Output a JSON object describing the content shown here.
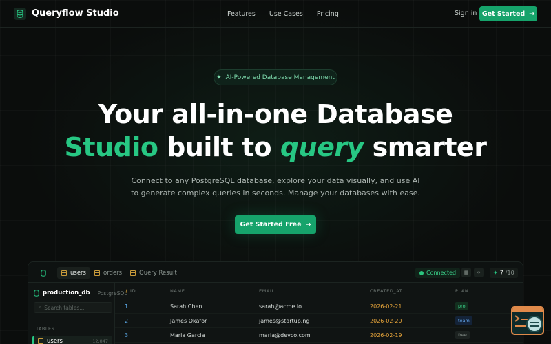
{
  "nav": {
    "brand": "Queryflow Studio",
    "links": [
      "Features",
      "Use Cases",
      "Pricing"
    ],
    "sign_in": "Sign in",
    "cta": "Get Started"
  },
  "hero": {
    "badge": "AI-Powered Database Management",
    "line1": "Your all-in-one Database",
    "line2_a": "Studio",
    "line2_b": " built to ",
    "line2_c": "query",
    "line2_d": " smarter",
    "subtitle": "Connect to any PostgreSQL database, explore your data visually, and use AI to generate complex queries in seconds. Manage your databases with ease.",
    "cta": "Get Started Free"
  },
  "app": {
    "tabs": [
      "users",
      "orders",
      "Query Result"
    ],
    "status": "Connected",
    "count_current": "7",
    "count_total": "/10",
    "sidebar": {
      "db_name": "production_db",
      "db_engine": "PostgreSQL",
      "search_placeholder": "Search tables...",
      "section": "TABLES",
      "items": [
        {
          "label": "users",
          "count": "12,847"
        }
      ]
    },
    "columns": [
      "ID",
      "NAME",
      "EMAIL",
      "CREATED_AT",
      "PLAN"
    ],
    "rows": [
      {
        "id": "1",
        "name": "Sarah Chen",
        "email": "sarah@acme.io",
        "created_at": "2026-02-21",
        "plan": "pro"
      },
      {
        "id": "2",
        "name": "James Okafor",
        "email": "james@startup.ng",
        "created_at": "2026-02-20",
        "plan": "team"
      },
      {
        "id": "3",
        "name": "Maria Garcia",
        "email": "maria@devco.com",
        "created_at": "2026-02-19",
        "plan": "free"
      }
    ]
  },
  "colors": {
    "accent": "#16a36b",
    "accent_text": "#27c783",
    "background": "#0b0d0c"
  }
}
